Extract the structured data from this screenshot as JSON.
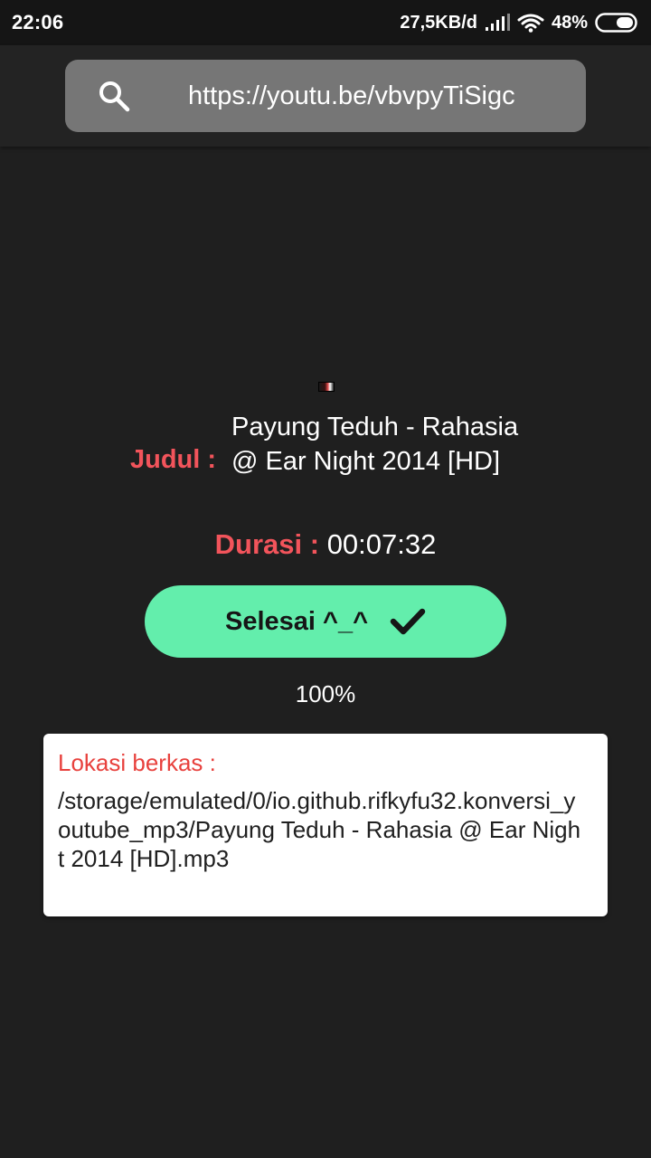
{
  "status_bar": {
    "time": "22:06",
    "net_speed": "27,5KB/d",
    "battery_pct": "48%",
    "icons": [
      "signal-icon",
      "wifi-icon",
      "battery-icon"
    ]
  },
  "search": {
    "value": "https://youtu.be/vbvpyTiSigc",
    "icon": "search-icon"
  },
  "video": {
    "title_label": "Judul :",
    "title": "Payung Teduh - Rahasia @ Ear Night 2014 [HD]",
    "duration_label": "Durasi :",
    "duration": "00:07:32"
  },
  "download": {
    "button_label": "Selesai ^_^",
    "button_icon": "check-icon",
    "progress": "100%"
  },
  "file": {
    "label": "Lokasi berkas :",
    "path": "/storage/emulated/0/io.github.rifkyfu32.konversi_youtube_mp3/Payung Teduh - Rahasia @ Ear Night 2014 [HD].mp3"
  },
  "colors": {
    "background": "#1f1f1f",
    "accent_red": "#f2545b",
    "button_green": "#63eeac",
    "search_box": "#767676"
  }
}
